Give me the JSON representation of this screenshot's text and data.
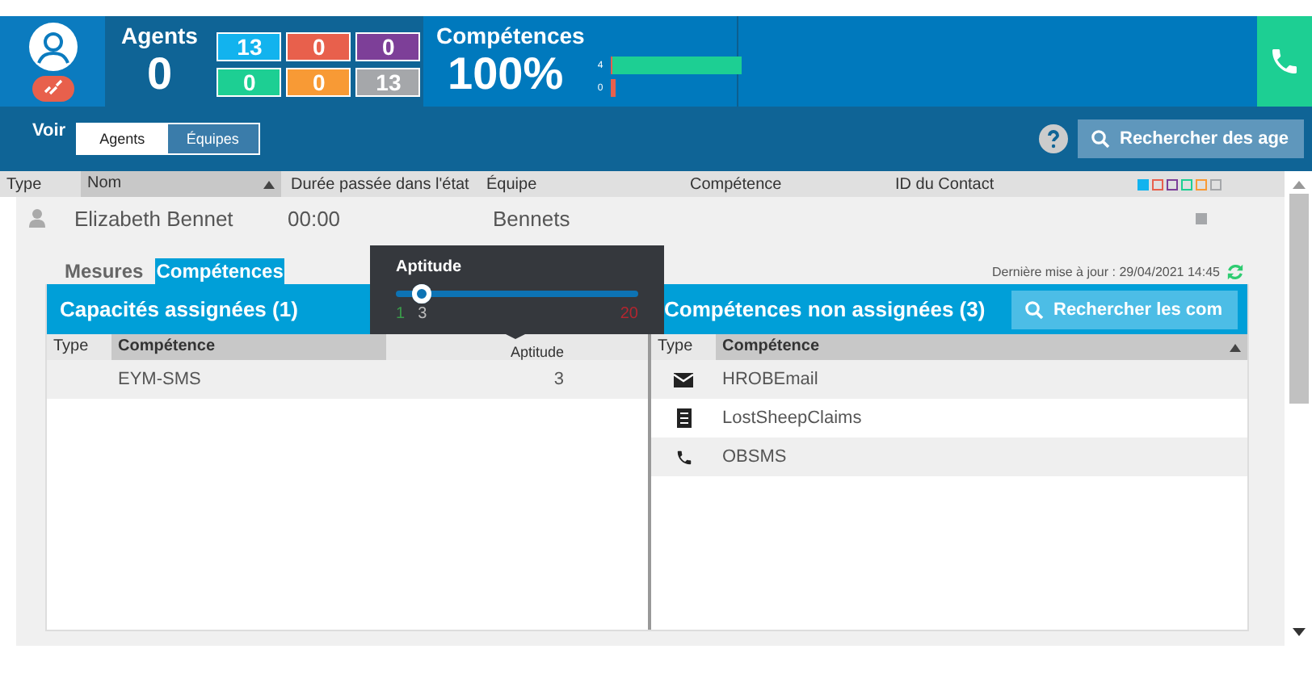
{
  "header": {
    "agents": {
      "label": "Agents",
      "value": "0",
      "counts": [
        {
          "value": "13",
          "color": "#12b3ee"
        },
        {
          "value": "0",
          "color": "#e8604c"
        },
        {
          "value": "0",
          "color": "#7d3f98"
        },
        {
          "value": "0",
          "color": "#1dcf93"
        },
        {
          "value": "0",
          "color": "#f89a35"
        },
        {
          "value": "13",
          "color": "#a5a7aa"
        }
      ]
    },
    "competences": {
      "label": "Compétences",
      "value": "100%",
      "bars": [
        {
          "label": "4",
          "level": 1,
          "color": "#1dcf93"
        },
        {
          "label": "0",
          "level": 0,
          "color": "#e8604c"
        }
      ]
    }
  },
  "toolbar": {
    "view_label": "Voir",
    "view_options": [
      {
        "label": "Agents",
        "selected": true
      },
      {
        "label": "Équipes",
        "selected": false
      }
    ],
    "search": {
      "placeholder": "Rechercher des age"
    }
  },
  "table": {
    "columns": [
      "Type",
      "Nom",
      "Durée passée dans l'état",
      "Équipe",
      "Compétence",
      "ID du Contact"
    ],
    "legend": [
      {
        "color": "#12b3ee",
        "filled": true
      },
      {
        "color": "#e8604c",
        "filled": false
      },
      {
        "color": "#7d3f98",
        "filled": false
      },
      {
        "color": "#1dcf93",
        "filled": false
      },
      {
        "color": "#f89a35",
        "filled": false
      },
      {
        "color": "#a5a7aa",
        "filled": false
      }
    ],
    "rows": [
      {
        "name": "Elizabeth Bennet",
        "duration": "00:00",
        "team": "Bennets"
      }
    ]
  },
  "detail": {
    "tabs": [
      {
        "label": "Mesures",
        "selected": false
      },
      {
        "label": "Compétences",
        "selected": true
      }
    ],
    "last_update": "Dernière mise à jour : 29/04/2021 14:45",
    "assigned": {
      "title": "Capacités assignées (1)",
      "columns": [
        "Type",
        "Compétence",
        "Aptitude"
      ],
      "rows": [
        {
          "name": "EYM-SMS",
          "aptitude": "3"
        }
      ]
    },
    "unassigned": {
      "title": "Compétences non assignées (3)",
      "search": {
        "placeholder": "Rechercher les com"
      },
      "columns": [
        "Type",
        "Compétence"
      ],
      "rows": [
        {
          "kind": "email",
          "name": "HROBEmail"
        },
        {
          "kind": "list",
          "name": "LostSheepClaims"
        },
        {
          "kind": "phone",
          "name": "OBSMS"
        }
      ]
    }
  },
  "tooltip": {
    "title": "Aptitude",
    "level": 0.105,
    "min": "1",
    "value": "3",
    "max": "20"
  }
}
